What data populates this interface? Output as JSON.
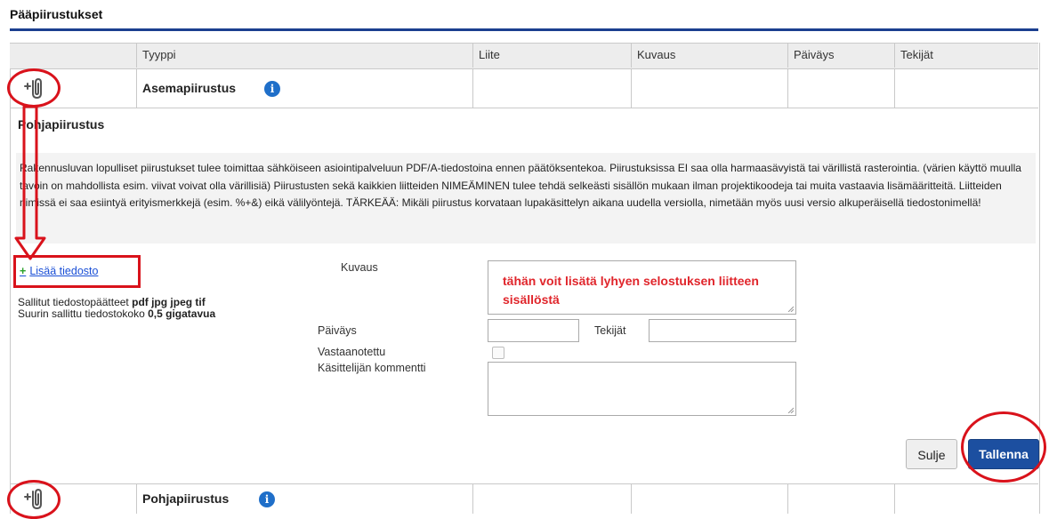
{
  "section": {
    "title": "Pääpiirustukset"
  },
  "table": {
    "headers": [
      "Tyyppi",
      "Liite",
      "Kuvaus",
      "Päiväys",
      "Tekijät"
    ],
    "rows": [
      {
        "type": "Asemapiirustus",
        "attach_icon": "paperclip-plus-icon",
        "info_icon": "info-icon"
      },
      {
        "type": "Pohjapiirustus",
        "attach_icon": "paperclip-plus-icon",
        "info_icon": "info-icon"
      }
    ]
  },
  "panel": {
    "title": "Pohjapiirustus",
    "note": "Rakennusluvan lopulliset piirustukset tulee toimittaa sähköiseen asiointipalveluun PDF/A-tiedostoina ennen päätöksentekoa. Piirustuksissa EI saa olla harmaasävyistä tai värillistä rasterointia. (värien käyttö muulla tavoin on mahdollista esim. viivat voivat olla värillisiä) Piirustusten sekä kaikkien liitteiden NIMEÄMINEN tulee tehdä selkeästi sisällön mukaan ilman projektikoodeja tai muita vastaavia lisämääritteitä. Liitteiden nimissä ei saa esiintyä erityismerkkejä (esim. %+&) eikä välilyöntejä. TÄRKEÄÄ: Mikäli piirustus korvataan lupakäsittelyn aikana uudella versiolla, nimetään myös uusi versio alkuperäisellä tiedostonimellä!",
    "add_file": "Lisää tiedosto",
    "allowed_label": "Sallitut tiedostopäätteet",
    "allowed_values": "pdf jpg jpeg tif",
    "maxsize_label": "Suurin sallittu tiedostokoko",
    "maxsize_value": "0,5 gigatavua",
    "form": {
      "kuvaus_label": "Kuvaus",
      "kuvaus_hint": "tähän voit lisätä  lyhyen selostuksen liitteen sisällöstä",
      "paivays_label": "Päiväys",
      "tekijat_label": "Tekijät",
      "vastaanotettu_label": "Vastaanotettu",
      "vastaanotettu_checked": false,
      "kommentti_label": "Käsittelijän kommentti"
    },
    "buttons": {
      "close": "Sulje",
      "save": "Tallenna"
    }
  },
  "colors": {
    "accent": "#1c4fa0",
    "title_rule": "#1b3f8f",
    "annotation": "#d9121b",
    "hint": "#e0252b",
    "info": "#1f6fc9"
  }
}
